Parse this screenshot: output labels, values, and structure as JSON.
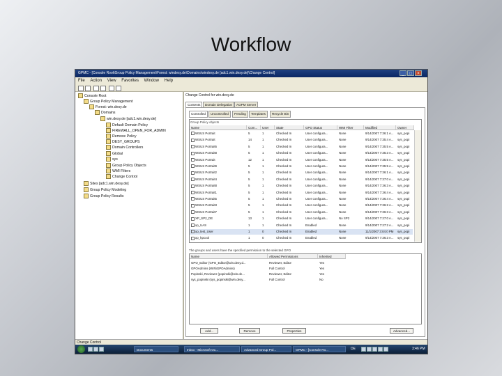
{
  "slide": {
    "title": "Workflow"
  },
  "window": {
    "title": "GPMC - [Console Root\\Group Policy Management\\Forest: windesy.de\\Domains\\windesy.de [adc1.win.desy.de]\\Change Control]",
    "menu": [
      "File",
      "Action",
      "View",
      "Favorites",
      "Window",
      "Help"
    ],
    "status": "Change Control"
  },
  "tree": [
    {
      "label": "Console Root",
      "level": 0
    },
    {
      "label": "Group Policy Management",
      "level": 1
    },
    {
      "label": "Forest: win.desy.de",
      "level": 2
    },
    {
      "label": "Domains",
      "level": 3
    },
    {
      "label": "win.desy.de [adc1.win.desy.de]",
      "level": 4
    },
    {
      "label": "Default Domain Policy",
      "level": 5
    },
    {
      "label": "FIREWALL_OPEN_FOR_ADMIN",
      "level": 5
    },
    {
      "label": "Remove Policy",
      "level": 5
    },
    {
      "label": "DESY_GROUPS",
      "level": 5
    },
    {
      "label": "Domain Controllers",
      "level": 5
    },
    {
      "label": "Global",
      "level": 5
    },
    {
      "label": "sys",
      "level": 5
    },
    {
      "label": "Group Policy Objects",
      "level": 5
    },
    {
      "label": "WMI Filters",
      "level": 5
    },
    {
      "label": "Change Control",
      "level": 5
    },
    {
      "label": "Sites [adc1.win.desy.de]",
      "level": 1
    },
    {
      "label": "Group Policy Modeling",
      "level": 1
    },
    {
      "label": "Group Policy Results",
      "level": 1
    }
  ],
  "right": {
    "header": "Change Control for win.desy.de",
    "tabs": [
      "Contents",
      "Domain Delegation",
      "AGPM Server"
    ],
    "subtabs": [
      "Controlled",
      "Uncontrolled",
      "Pending",
      "Templates",
      "Recycle Bin"
    ],
    "gpo_label": "Group Policy objects",
    "columns": [
      "Name",
      "Com...",
      "User",
      "State",
      "GPO Status",
      "WMI Filter",
      "Modified",
      "Owner"
    ],
    "rows": [
      [
        "WSUS Portrait",
        "5",
        "1",
        "Checked In",
        "User configura...",
        "None",
        "9/14/2007 7:36:1 A...",
        "sys_popi"
      ],
      [
        "WSUS Portrait",
        "14",
        "1",
        "Checked In",
        "User configura...",
        "None",
        "9/14/2007 7:35:4 A...",
        "sys_popi"
      ],
      [
        "WSUS Portrait6",
        "5",
        "1",
        "Checked In",
        "User configura...",
        "None",
        "9/14/2007 7:35:5 A...",
        "sys_popi"
      ],
      [
        "WSUS Portrait8",
        "5",
        "1",
        "Checked In",
        "User configura...",
        "None",
        "9/14/2007 7:35:3 A...",
        "sys_popi"
      ],
      [
        "WSUS Portrait",
        "12",
        "1",
        "Checked In",
        "User configura...",
        "None",
        "9/14/2007 7:35:5 A...",
        "sys_popi"
      ],
      [
        "WSUS Portrait9",
        "5",
        "1",
        "Checked In",
        "User configura...",
        "None",
        "9/14/2007 7:35:5 A...",
        "sys_popi"
      ],
      [
        "WSUS Portrait2",
        "5",
        "1",
        "Checked In",
        "User configura...",
        "None",
        "9/14/2007 7:36:1 A...",
        "sys_popi"
      ],
      [
        "WSUS Portrait4",
        "5",
        "1",
        "Checked In",
        "User configura...",
        "None",
        "9/14/2007 7:37:0 A...",
        "sys_popi"
      ],
      [
        "WSUS Portrait8",
        "5",
        "1",
        "Checked In",
        "User configura...",
        "None",
        "9/14/2007 7:36:3 A...",
        "sys_popi"
      ],
      [
        "WSUS Portrait1",
        "5",
        "1",
        "Checked In",
        "User configura...",
        "None",
        "9/14/2007 7:36:4 A...",
        "sys_popi"
      ],
      [
        "WSUS Portrait5",
        "5",
        "1",
        "Checked In",
        "User configura...",
        "None",
        "9/14/2007 7:36:4 A...",
        "sys_popi"
      ],
      [
        "WSUS Portrait3",
        "5",
        "1",
        "Checked In",
        "User configura...",
        "None",
        "9/14/2007 7:36:2 A...",
        "sys_popi"
      ],
      [
        "WSUS Portrait7",
        "5",
        "1",
        "Checked In",
        "User configura...",
        "None",
        "9/14/2007 7:36:3 A...",
        "sys_popi"
      ],
      [
        "XP_SP2_DE",
        "13",
        "1",
        "Checked In",
        "User configura...",
        "No SP2",
        "9/14/2007 7:27:0 A...",
        "sys_popi"
      ],
      [
        "xp_UAS",
        "1",
        "1",
        "Checked In",
        "Enabled",
        "None",
        "9/14/2007 7:27:2 A...",
        "sys_popi"
      ],
      [
        "xp_test_User",
        "1",
        "0",
        "Checked In",
        "Enabled",
        "None",
        "11/1/2007 3:04:0 PM",
        "sys_popi"
      ],
      [
        "xp_hpcool",
        "1",
        "0",
        "Checked In",
        "Enabled",
        "None",
        "9/14/2007 7:36:3 A...",
        "sys_popi"
      ]
    ],
    "perm_label": "The groups and users have the specified permission to the selected GPO",
    "perm_columns": [
      "Name",
      "Allowed Permissions",
      "Inherited"
    ],
    "perm_rows": [
      [
        "GPO_Editor (GPO_Editor@win.desy.d...",
        "Reviewer, Editor",
        "Yes"
      ],
      [
        "GPOAdmins (WIN\\GPOAdmins)",
        "Full Control",
        "Yes"
      ],
      [
        "Popinski, Reviewer (popinski@win.de...",
        "Reviewer, Editor",
        "Yes"
      ],
      [
        "sys_popinski (sys_popinski@win.desy...",
        "Full Control",
        "No"
      ]
    ],
    "buttons": [
      "Add...",
      "Remove",
      "Properties",
      "Advanced..."
    ]
  },
  "taskbar": {
    "items": [
      "Documents",
      "Inbox - Microsoft Ou...",
      "Advanced Group Pol...",
      "GPMC - [Console Ro..."
    ],
    "lang": "DE",
    "clock": "3:46 PM"
  }
}
